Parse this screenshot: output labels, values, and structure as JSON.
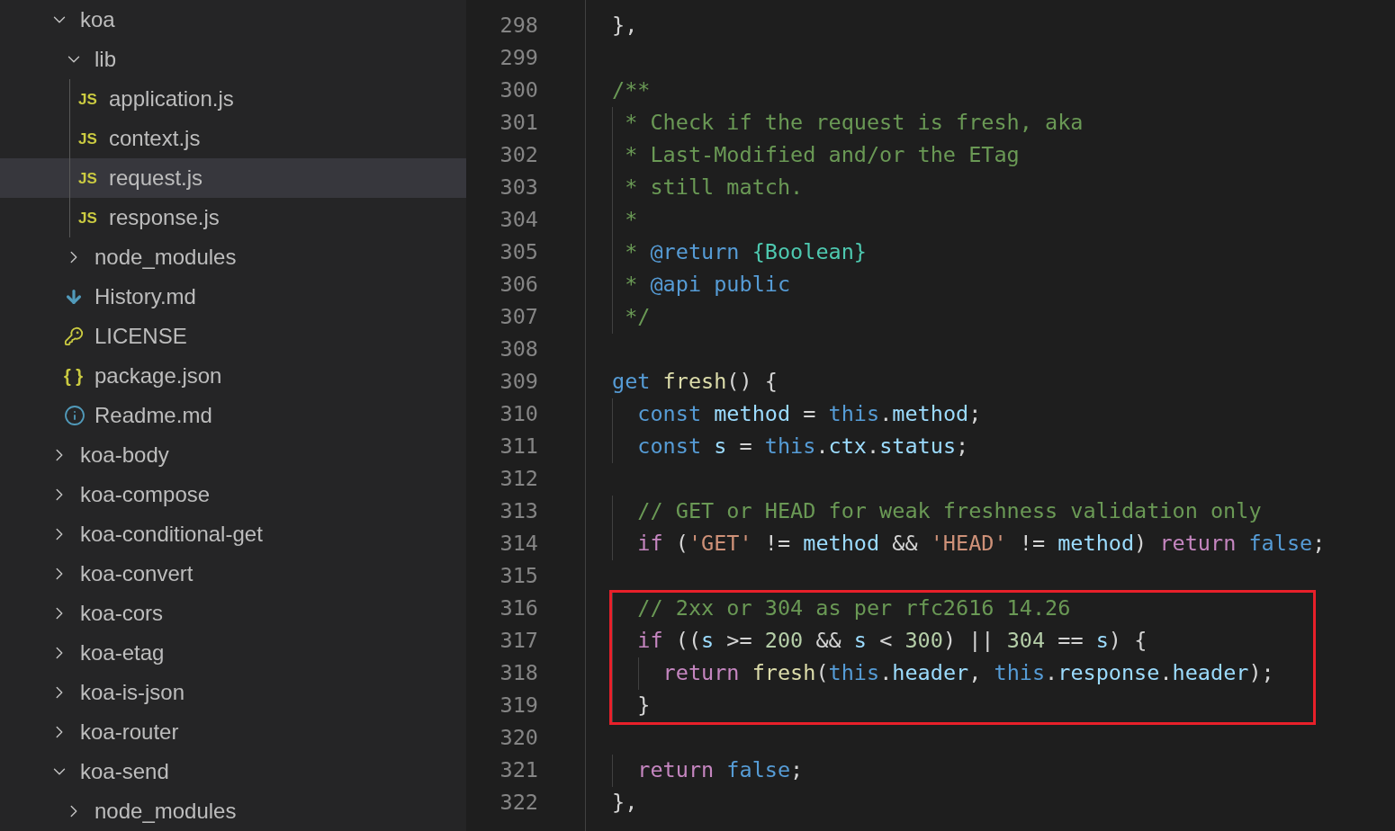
{
  "sidebar": {
    "items": [
      {
        "name": "koa",
        "kind": "folder",
        "expanded": true,
        "selected": false,
        "children": [
          {
            "name": "lib",
            "kind": "folder",
            "expanded": true,
            "selected": false,
            "children": [
              {
                "name": "application.js",
                "kind": "js",
                "icon_label": "JS",
                "selected": false
              },
              {
                "name": "context.js",
                "kind": "js",
                "icon_label": "JS",
                "selected": false
              },
              {
                "name": "request.js",
                "kind": "js",
                "icon_label": "JS",
                "selected": true
              },
              {
                "name": "response.js",
                "kind": "js",
                "icon_label": "JS",
                "selected": false
              }
            ]
          },
          {
            "name": "node_modules",
            "kind": "folder",
            "expanded": false,
            "selected": false
          },
          {
            "name": "History.md",
            "kind": "markdown",
            "selected": false
          },
          {
            "name": "LICENSE",
            "kind": "license",
            "selected": false
          },
          {
            "name": "package.json",
            "kind": "json",
            "icon_label": "{ }",
            "selected": false
          },
          {
            "name": "Readme.md",
            "kind": "readme",
            "selected": false
          }
        ]
      },
      {
        "name": "koa-body",
        "kind": "folder",
        "expanded": false,
        "selected": false
      },
      {
        "name": "koa-compose",
        "kind": "folder",
        "expanded": false,
        "selected": false
      },
      {
        "name": "koa-conditional-get",
        "kind": "folder",
        "expanded": false,
        "selected": false
      },
      {
        "name": "koa-convert",
        "kind": "folder",
        "expanded": false,
        "selected": false
      },
      {
        "name": "koa-cors",
        "kind": "folder",
        "expanded": false,
        "selected": false
      },
      {
        "name": "koa-etag",
        "kind": "folder",
        "expanded": false,
        "selected": false
      },
      {
        "name": "koa-is-json",
        "kind": "folder",
        "expanded": false,
        "selected": false
      },
      {
        "name": "koa-router",
        "kind": "folder",
        "expanded": false,
        "selected": false
      },
      {
        "name": "koa-send",
        "kind": "folder",
        "expanded": true,
        "selected": false,
        "children": [
          {
            "name": "node_modules",
            "kind": "folder",
            "expanded": false,
            "selected": false
          }
        ]
      }
    ]
  },
  "editor": {
    "blocks": [
      {
        "highlighted": false,
        "lines": [
          {
            "number": "298",
            "tokens": [
              {
                "text": "},",
                "kind": "plain"
              }
            ]
          },
          {
            "number": "299"
          },
          {
            "number": "300",
            "tokens": [
              {
                "text": "/**",
                "kind": "comment"
              }
            ]
          },
          {
            "number": "301",
            "tokens": [
              {
                "text": " * Check if the request is fresh, aka",
                "kind": "comment"
              }
            ]
          },
          {
            "number": "302",
            "tokens": [
              {
                "text": " * Last-Modified and/or the ETag",
                "kind": "comment"
              }
            ]
          },
          {
            "number": "303",
            "tokens": [
              {
                "text": " * still match.",
                "kind": "comment"
              }
            ]
          },
          {
            "number": "304",
            "tokens": [
              {
                "text": " *",
                "kind": "comment"
              }
            ]
          },
          {
            "number": "305",
            "tokens": [
              {
                "text": " * ",
                "kind": "comment"
              },
              {
                "text": "@return ",
                "kind": "keyword"
              },
              {
                "text": "{Boolean}",
                "kind": "type"
              }
            ]
          },
          {
            "number": "306",
            "tokens": [
              {
                "text": " * ",
                "kind": "comment"
              },
              {
                "text": "@api public",
                "kind": "keyword"
              }
            ]
          },
          {
            "number": "307",
            "tokens": [
              {
                "text": " */",
                "kind": "comment"
              }
            ]
          },
          {
            "number": "308"
          },
          {
            "number": "309",
            "tokens": [
              {
                "text": "get ",
                "kind": "keyword"
              },
              {
                "text": "fresh",
                "kind": "func"
              },
              {
                "text": "() {",
                "kind": "plain"
              }
            ]
          },
          {
            "number": "310",
            "tokens": [
              {
                "text": "  const",
                "kind": "keyword"
              },
              {
                "text": " method",
                "kind": "var"
              },
              {
                "text": " = ",
                "kind": "plain"
              },
              {
                "text": "this",
                "kind": "keyword"
              },
              {
                "text": ".",
                "kind": "plain"
              },
              {
                "text": "method",
                "kind": "var"
              },
              {
                "text": ";",
                "kind": "plain"
              }
            ]
          },
          {
            "number": "311",
            "tokens": [
              {
                "text": "  const",
                "kind": "keyword"
              },
              {
                "text": " s",
                "kind": "var"
              },
              {
                "text": " = ",
                "kind": "plain"
              },
              {
                "text": "this",
                "kind": "keyword"
              },
              {
                "text": ".",
                "kind": "plain"
              },
              {
                "text": "ctx",
                "kind": "var"
              },
              {
                "text": ".",
                "kind": "plain"
              },
              {
                "text": "status",
                "kind": "var"
              },
              {
                "text": ";",
                "kind": "plain"
              }
            ]
          },
          {
            "number": "312"
          },
          {
            "number": "313",
            "tokens": [
              {
                "text": "  // GET or HEAD for weak freshness validation only",
                "kind": "comment"
              }
            ]
          },
          {
            "number": "314",
            "tokens": [
              {
                "text": "  if",
                "kind": "control"
              },
              {
                "text": " (",
                "kind": "plain"
              },
              {
                "text": "'GET'",
                "kind": "string"
              },
              {
                "text": " != ",
                "kind": "plain"
              },
              {
                "text": "method",
                "kind": "var"
              },
              {
                "text": " && ",
                "kind": "plain"
              },
              {
                "text": "'HEAD'",
                "kind": "string"
              },
              {
                "text": " != ",
                "kind": "plain"
              },
              {
                "text": "method",
                "kind": "var"
              },
              {
                "text": ") ",
                "kind": "plain"
              },
              {
                "text": "return ",
                "kind": "control"
              },
              {
                "text": "false",
                "kind": "keyword"
              },
              {
                "text": ";",
                "kind": "plain"
              }
            ]
          },
          {
            "number": "315"
          }
        ]
      },
      {
        "highlighted": true,
        "lines": [
          {
            "number": "316",
            "tokens": [
              {
                "text": "  // 2xx or 304 as per rfc2616 14.26",
                "kind": "comment"
              }
            ]
          },
          {
            "number": "317",
            "tokens": [
              {
                "text": "  if",
                "kind": "control"
              },
              {
                "text": " ((",
                "kind": "plain"
              },
              {
                "text": "s",
                "kind": "var"
              },
              {
                "text": " >= ",
                "kind": "plain"
              },
              {
                "text": "200",
                "kind": "number"
              },
              {
                "text": " && ",
                "kind": "plain"
              },
              {
                "text": "s",
                "kind": "var"
              },
              {
                "text": " < ",
                "kind": "plain"
              },
              {
                "text": "300",
                "kind": "number"
              },
              {
                "text": ") || ",
                "kind": "plain"
              },
              {
                "text": "304",
                "kind": "number"
              },
              {
                "text": " == ",
                "kind": "plain"
              },
              {
                "text": "s",
                "kind": "var"
              },
              {
                "text": ") {",
                "kind": "plain"
              }
            ]
          },
          {
            "number": "318",
            "tokens": [
              {
                "text": "    return ",
                "kind": "control"
              },
              {
                "text": "fresh",
                "kind": "func"
              },
              {
                "text": "(",
                "kind": "plain"
              },
              {
                "text": "this",
                "kind": "keyword"
              },
              {
                "text": ".",
                "kind": "plain"
              },
              {
                "text": "header",
                "kind": "var"
              },
              {
                "text": ", ",
                "kind": "plain"
              },
              {
                "text": "this",
                "kind": "keyword"
              },
              {
                "text": ".",
                "kind": "plain"
              },
              {
                "text": "response",
                "kind": "var"
              },
              {
                "text": ".",
                "kind": "plain"
              },
              {
                "text": "header",
                "kind": "var"
              },
              {
                "text": ");",
                "kind": "plain"
              }
            ]
          },
          {
            "number": "319",
            "tokens": [
              {
                "text": "  }",
                "kind": "plain"
              }
            ]
          }
        ]
      },
      {
        "highlighted": false,
        "lines": [
          {
            "number": "320"
          },
          {
            "number": "321",
            "tokens": [
              {
                "text": "  return ",
                "kind": "control"
              },
              {
                "text": "false",
                "kind": "keyword"
              },
              {
                "text": ";",
                "kind": "plain"
              }
            ]
          },
          {
            "number": "322",
            "tokens": [
              {
                "text": "},",
                "kind": "plain"
              }
            ]
          }
        ]
      }
    ]
  }
}
